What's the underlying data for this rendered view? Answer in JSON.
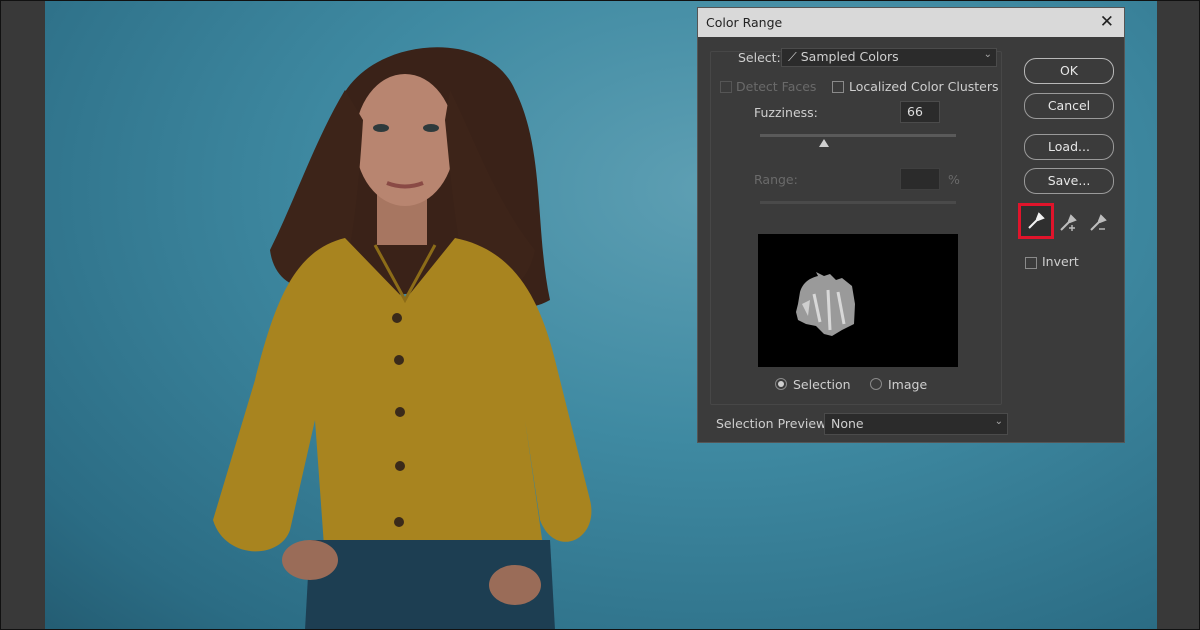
{
  "dialog": {
    "title": "Color Range",
    "close_glyph": "✕",
    "select_label": "Select:",
    "select_value": "Sampled Colors",
    "detect_faces_label": "Detect Faces",
    "localized_label": "Localized Color Clusters",
    "fuzziness_label": "Fuzziness:",
    "fuzziness_value": "66",
    "range_label": "Range:",
    "range_unit": "%",
    "radio_selection": "Selection",
    "radio_image": "Image",
    "preview_label": "Selection Preview:",
    "preview_value": "None",
    "ok": "OK",
    "cancel": "Cancel",
    "load": "Load...",
    "save": "Save...",
    "invert": "Invert"
  },
  "colors": {
    "highlight": "#e0142b",
    "shirt": "#a8841f",
    "background": "#3f8aa2"
  },
  "icons": [
    "eyedropper-icon",
    "eyedropper-plus-icon",
    "eyedropper-minus-icon",
    "close-icon",
    "chevron-down-icon"
  ]
}
